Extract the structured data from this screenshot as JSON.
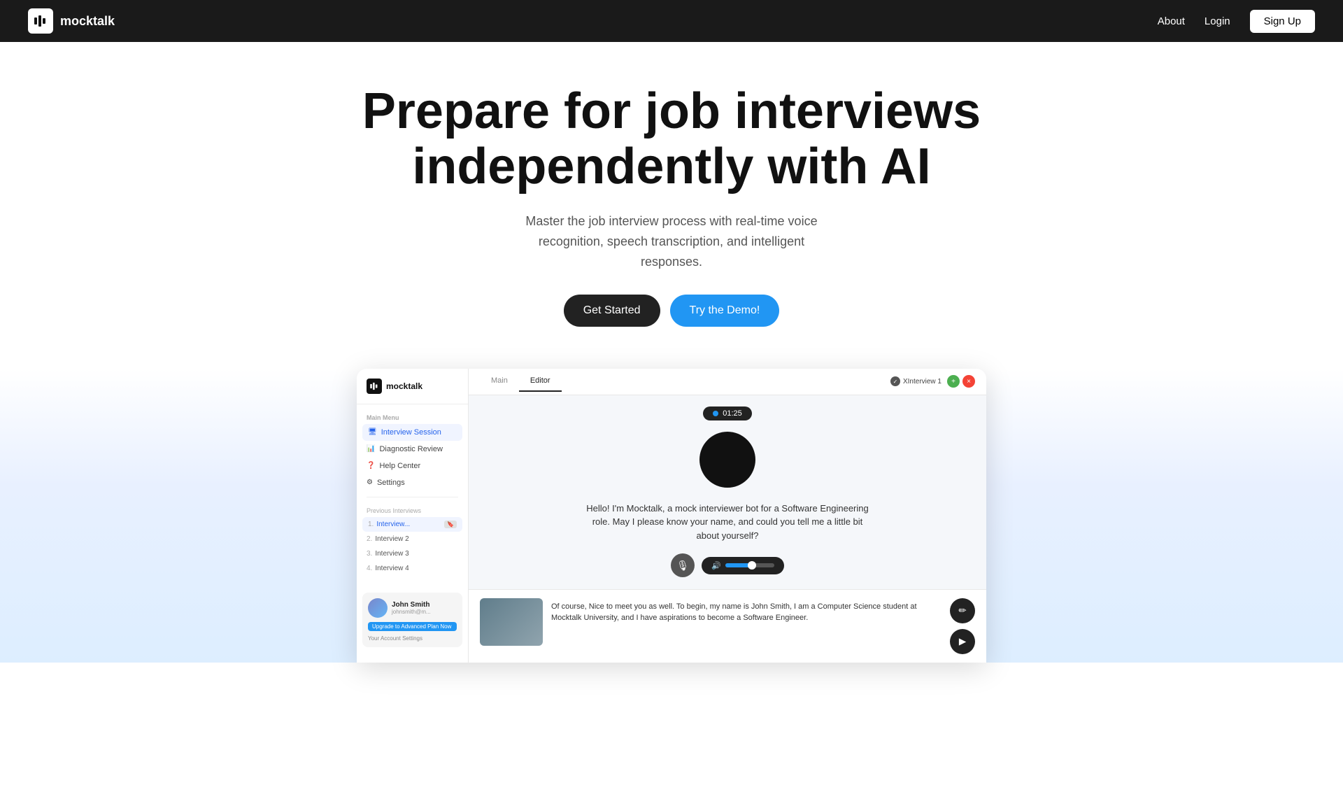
{
  "nav": {
    "logo_text": "mocktalk",
    "about_label": "About",
    "login_label": "Login",
    "signup_label": "Sign Up"
  },
  "hero": {
    "title_line1": "Prepare for job interviews",
    "title_line2": "independently with AI",
    "subtitle": "Master the job interview process with real-time voice recognition, speech transcription, and intelligent responses.",
    "cta_primary": "Get Started",
    "cta_demo": "Try the Demo!"
  },
  "demo": {
    "sidebar": {
      "logo_text": "mocktalk",
      "section_label": "Main Menu",
      "menu_items": [
        {
          "icon": "🖥",
          "label": "Interview Session",
          "active": true
        },
        {
          "icon": "📊",
          "label": "Diagnostic Review",
          "active": false
        },
        {
          "icon": "❓",
          "label": "Help Center",
          "active": false
        },
        {
          "icon": "⚙",
          "label": "Settings",
          "active": false
        }
      ],
      "prev_label": "Previous Interviews",
      "interviews": [
        {
          "num": "1.",
          "label": "Interview...",
          "active": true,
          "badge": "🔖"
        },
        {
          "num": "2.",
          "label": "Interview 2",
          "active": false
        },
        {
          "num": "3.",
          "label": "Interview 3",
          "active": false
        },
        {
          "num": "4.",
          "label": "Interview 4",
          "active": false
        }
      ],
      "user": {
        "name": "John Smith",
        "email": "johnsmith@m...",
        "plan": "Upgrade to Advanced Plan Now",
        "settings": "Your Account Settings"
      }
    },
    "topbar": {
      "tabs": [
        {
          "label": "Main",
          "active": false
        },
        {
          "label": "Editor",
          "active": true
        }
      ],
      "interview_label": "XInterview 1"
    },
    "timer": "01:25",
    "question": "Hello! I'm Mocktalk, a mock interviewer bot for a Software Engineering role. May I please know your name, and could you tell me a little bit about yourself?",
    "response_text": "Of course, Nice to meet you as well. To begin, my name is John Smith, I am a Computer Science student at Mocktalk University, and I have aspirations to become a Software Engineer."
  }
}
